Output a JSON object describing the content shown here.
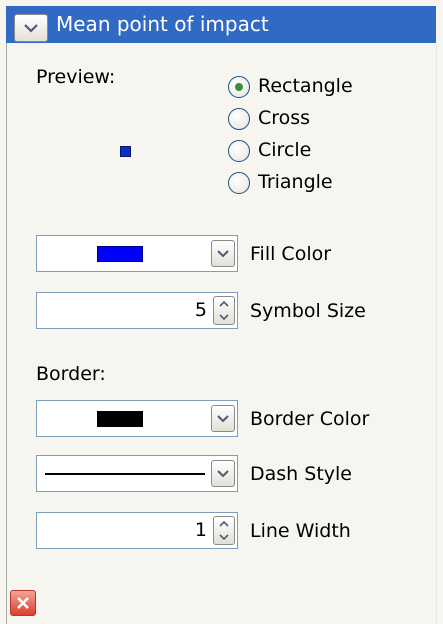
{
  "header": {
    "title": "Mean point of impact"
  },
  "preview": {
    "label": "Preview:",
    "symbol_color": "#0a30c8"
  },
  "shape": {
    "selected": "Rectangle",
    "options": [
      "Rectangle",
      "Cross",
      "Circle",
      "Triangle"
    ]
  },
  "fill": {
    "color": "#0000ff",
    "label": "Fill Color"
  },
  "symbol_size": {
    "value": "5",
    "label": "Symbol Size"
  },
  "border": {
    "label": "Border:",
    "color": "#000000",
    "color_label": "Border Color",
    "dash_style_label": "Dash Style",
    "line_width": "1",
    "line_width_label": "Line Width"
  },
  "icons": {
    "collapse": "chevron-down-icon",
    "remove": "close-icon"
  }
}
